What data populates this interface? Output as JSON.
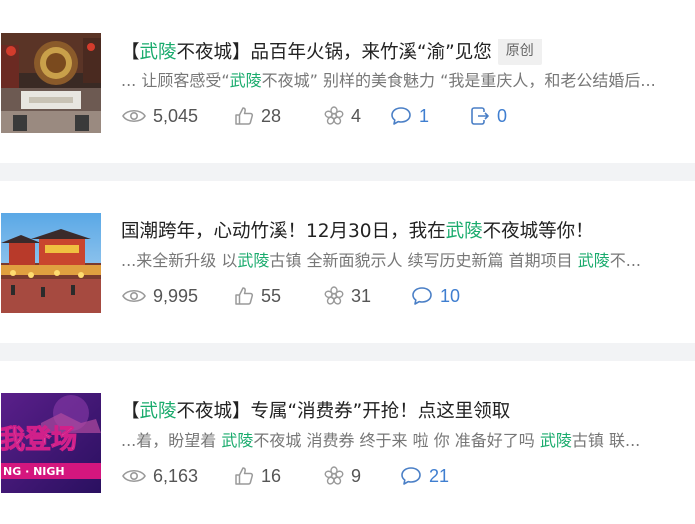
{
  "articles": [
    {
      "title_pre": "【",
      "title_kw": "武陵",
      "title_post": "不夜城】品百年火锅，来竹溪“渝”见您",
      "tag": "原创",
      "snippet_a": "... 让顾客感受“",
      "snippet_kw": "武陵",
      "snippet_b": "不夜城” 别样的美食魅力 “我是重庆人，和老公结婚后...",
      "stats": {
        "views": "5,045",
        "likes": "28",
        "shares": "4",
        "comments": "1",
        "forwards": "0"
      },
      "thumb_icon": "hotpot-restaurant-thumbnail"
    },
    {
      "title_pre": "国潮跨年，心动竹溪！12月30日，我在",
      "title_kw": "武陵",
      "title_post": "不夜城等你！",
      "snippet_a": "...来全新升级 以",
      "snippet_kw": "武陵",
      "snippet_b": "古镇 全新面貌示人 续写历史新篇 首期项目 ",
      "snippet_kw2": "武陵",
      "snippet_c": "不...",
      "stats": {
        "views": "9,995",
        "likes": "55",
        "shares": "31",
        "comments": "10"
      },
      "thumb_icon": "ancient-town-night-thumbnail"
    },
    {
      "title_pre": "【",
      "title_kw": "武陵",
      "title_post": "不夜城】专属“消费券”开抢！点这里领取",
      "snippet_a": "...着，盼望着 ",
      "snippet_kw": "武陵",
      "snippet_b": "不夜城 消费券 终于来 啦 你 准备好了吗 ",
      "snippet_kw2": "武陵",
      "snippet_c": "古镇 联...",
      "stats": {
        "views": "6,163",
        "likes": "16",
        "shares": "9",
        "comments": "21"
      },
      "thumb_text_a": "我登场",
      "thumb_text_b": "NG · NIGH",
      "thumb_icon": "purple-poster-thumbnail"
    }
  ],
  "colors": {
    "keyword": "#1aab6d",
    "comment_blue": "#3f7ed0",
    "icon_gray": "#9a9a9a"
  }
}
